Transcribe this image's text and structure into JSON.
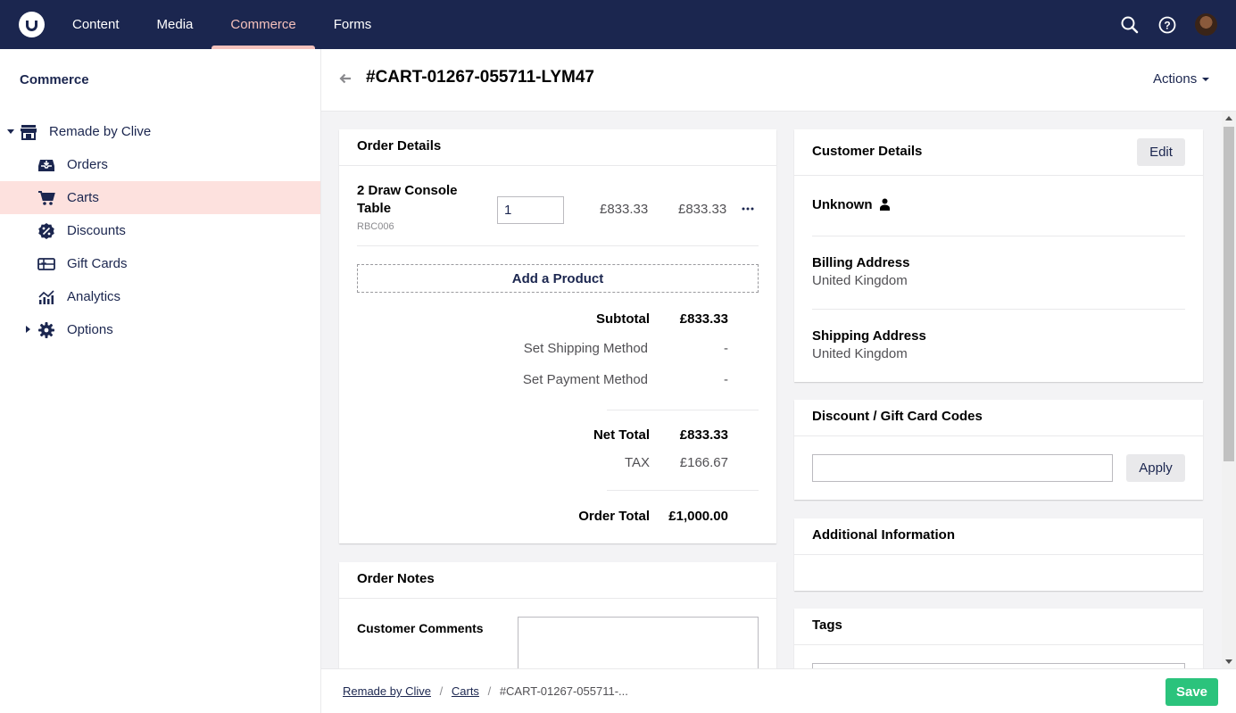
{
  "topbar": {
    "nav": [
      "Content",
      "Media",
      "Commerce",
      "Forms"
    ],
    "active_nav": "Commerce",
    "accent_color": "#f5c1bc",
    "bg_color": "#1b264f"
  },
  "sidebar": {
    "title": "Commerce",
    "store": "Remade by Clive",
    "items": [
      {
        "label": "Orders",
        "icon": "inbox-icon"
      },
      {
        "label": "Carts",
        "icon": "cart-icon"
      },
      {
        "label": "Discounts",
        "icon": "discount-badge-icon"
      },
      {
        "label": "Gift Cards",
        "icon": "gift-card-icon"
      },
      {
        "label": "Analytics",
        "icon": "analytics-icon"
      },
      {
        "label": "Options",
        "icon": "gear-icon"
      }
    ]
  },
  "header": {
    "title": "#CART-01267-055711-LYM47",
    "actions": "Actions"
  },
  "order_details": {
    "title": "Order Details",
    "line_item": {
      "name": "2 Draw Console Table",
      "name_line1": "2 Draw Console",
      "name_line2": "Table",
      "sku": "RBC006",
      "quantity": "1",
      "unit_price": "£833.33",
      "total_price": "£833.33"
    },
    "add_product": "Add a Product",
    "subtotal_label": "Subtotal",
    "subtotal_value": "£833.33",
    "shipping_label": "Set Shipping Method",
    "shipping_value": "-",
    "payment_label": "Set Payment Method",
    "payment_value": "-",
    "net_total_label": "Net Total",
    "net_total_value": "£833.33",
    "tax_label": "TAX",
    "tax_value": "£166.67",
    "order_total_label": "Order Total",
    "order_total_value": "£1,000.00"
  },
  "order_notes": {
    "title": "Order Notes",
    "customer_comments_label": "Customer Comments"
  },
  "customer_details": {
    "title": "Customer Details",
    "edit": "Edit",
    "customer_name": "Unknown",
    "billing_label": "Billing Address",
    "billing_value": "United Kingdom",
    "shipping_label": "Shipping Address",
    "shipping_value": "United Kingdom"
  },
  "discount_codes": {
    "title": "Discount / Gift Card Codes",
    "apply": "Apply"
  },
  "additional_info": {
    "title": "Additional Information"
  },
  "tags": {
    "title": "Tags"
  },
  "footer": {
    "breadcrumb": [
      "Remade by Clive",
      "Carts",
      "#CART-01267-055711-..."
    ],
    "save": "Save",
    "save_color": "#2bc37c"
  }
}
